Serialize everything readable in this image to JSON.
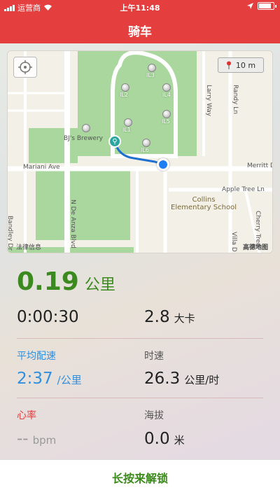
{
  "status_bar": {
    "carrier": "运营商",
    "time": "上午11:48",
    "battery_level": 0.85
  },
  "header": {
    "title": "骑车"
  },
  "map": {
    "scale_label": "10 m",
    "streets": [
      "Mariani Ave",
      "Merritt D",
      "Apple Tree Ln",
      "Larry Way",
      "Randy Ln",
      "Bandley Dr",
      "N De Anza Blvd",
      "Cherry Tree",
      "Villa D"
    ],
    "places": [
      "BJ's Brewery"
    ],
    "school": [
      "Collins",
      "Elementary School"
    ],
    "pins": [
      "IL3",
      "IL2",
      "IL4",
      "IL5",
      "IL1",
      "IL6"
    ],
    "legal": "法律信息",
    "attribution": "高德地图"
  },
  "stats": {
    "distance": {
      "value": "0.19",
      "unit": "公里"
    },
    "duration": {
      "value": "0:00:30"
    },
    "calories": {
      "value": "2.8",
      "unit": "大卡"
    },
    "avg_pace": {
      "label": "平均配速",
      "value": "2:37",
      "unit": "/公里"
    },
    "speed": {
      "label": "时速",
      "value": "26.3",
      "unit": "公里/时"
    },
    "heart_rate": {
      "label": "心率",
      "value": "--",
      "unit": "bpm"
    },
    "altitude": {
      "label": "海拔",
      "value": "0.0",
      "unit": "米"
    }
  },
  "bottom": {
    "unlock_label": "长按来解锁"
  },
  "colors": {
    "header": "#e43e3e",
    "distance": "#3b8a1f",
    "pace": "#2f8fe0",
    "heart": "#e43e3e",
    "route": "#1f6fd0"
  }
}
